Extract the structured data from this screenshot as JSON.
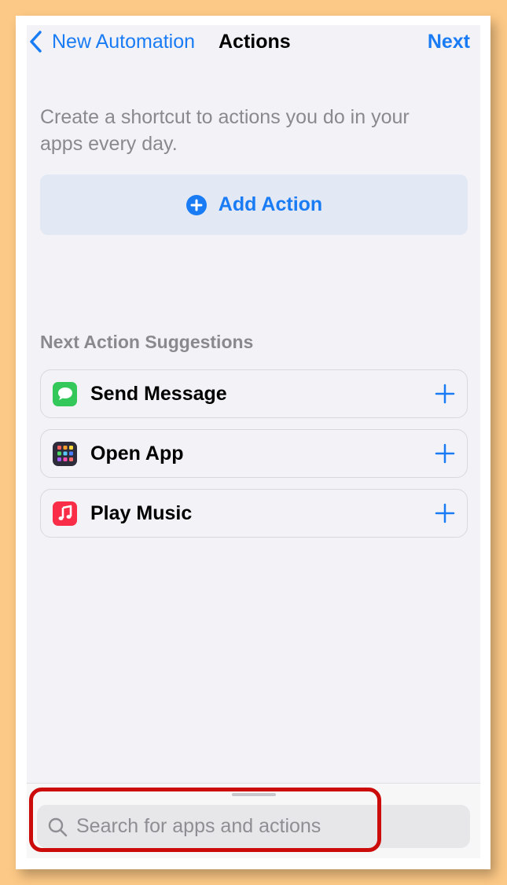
{
  "nav": {
    "back_label": "New Automation",
    "title": "Actions",
    "next_label": "Next"
  },
  "intro_text": "Create a shortcut to actions you do in your apps every day.",
  "add_action_label": "Add Action",
  "suggestions": {
    "title": "Next Action Suggestions",
    "items": [
      {
        "label": "Send Message",
        "icon": "messages-icon",
        "color": "#34c759"
      },
      {
        "label": "Open App",
        "icon": "app-grid-icon",
        "color": "#2c2c3a"
      },
      {
        "label": "Play Music",
        "icon": "music-icon",
        "color": "#fa2d48"
      }
    ]
  },
  "search": {
    "placeholder": "Search for apps and actions"
  },
  "colors": {
    "accent": "#1a7cf5",
    "highlight": "#cc0b0b",
    "background": "#f2f2f7"
  }
}
